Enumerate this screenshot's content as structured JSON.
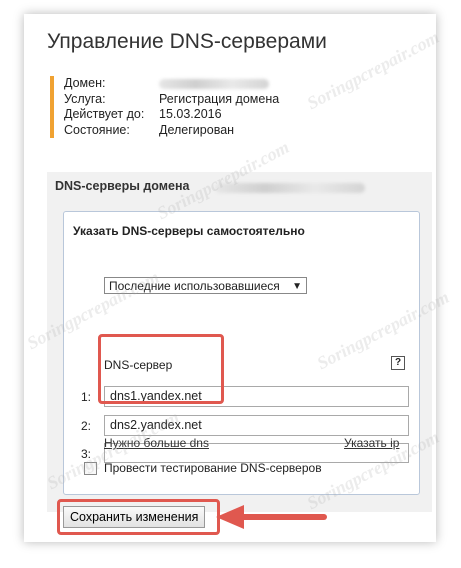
{
  "page": {
    "title": "Управление DNS-серверами"
  },
  "domain_info": {
    "rows": [
      {
        "label": "Домен:",
        "value": ""
      },
      {
        "label": "Услуга:",
        "value": "Регистрация домена"
      },
      {
        "label": "Действует до:",
        "value": "15.03.2016"
      },
      {
        "label": "Состояние:",
        "value": "Делегирован"
      }
    ]
  },
  "dns_section": {
    "title": "DNS-серверы домена",
    "manual_title": "Указать DNS-серверы самостоятельно",
    "preset_select": "Последние использовавшиеся",
    "column_header": "DNS-сервер",
    "help": "?",
    "servers": [
      {
        "num": "1:",
        "value": "dns1.yandex.net"
      },
      {
        "num": "2:",
        "value": "dns2.yandex.net"
      },
      {
        "num": "3:",
        "value": ""
      }
    ],
    "more_dns_link": "Нужно больше dns",
    "specify_ip_link": "Указать ip",
    "test_checkbox_label": "Провести тестирование DNS-серверов",
    "test_checked": false
  },
  "save_button": "Сохранить изменения",
  "watermark": "Soringpcrepair.com",
  "colors": {
    "accent_bar": "#f0a232",
    "highlight": "#e0584f",
    "border": "#b9c7da"
  }
}
